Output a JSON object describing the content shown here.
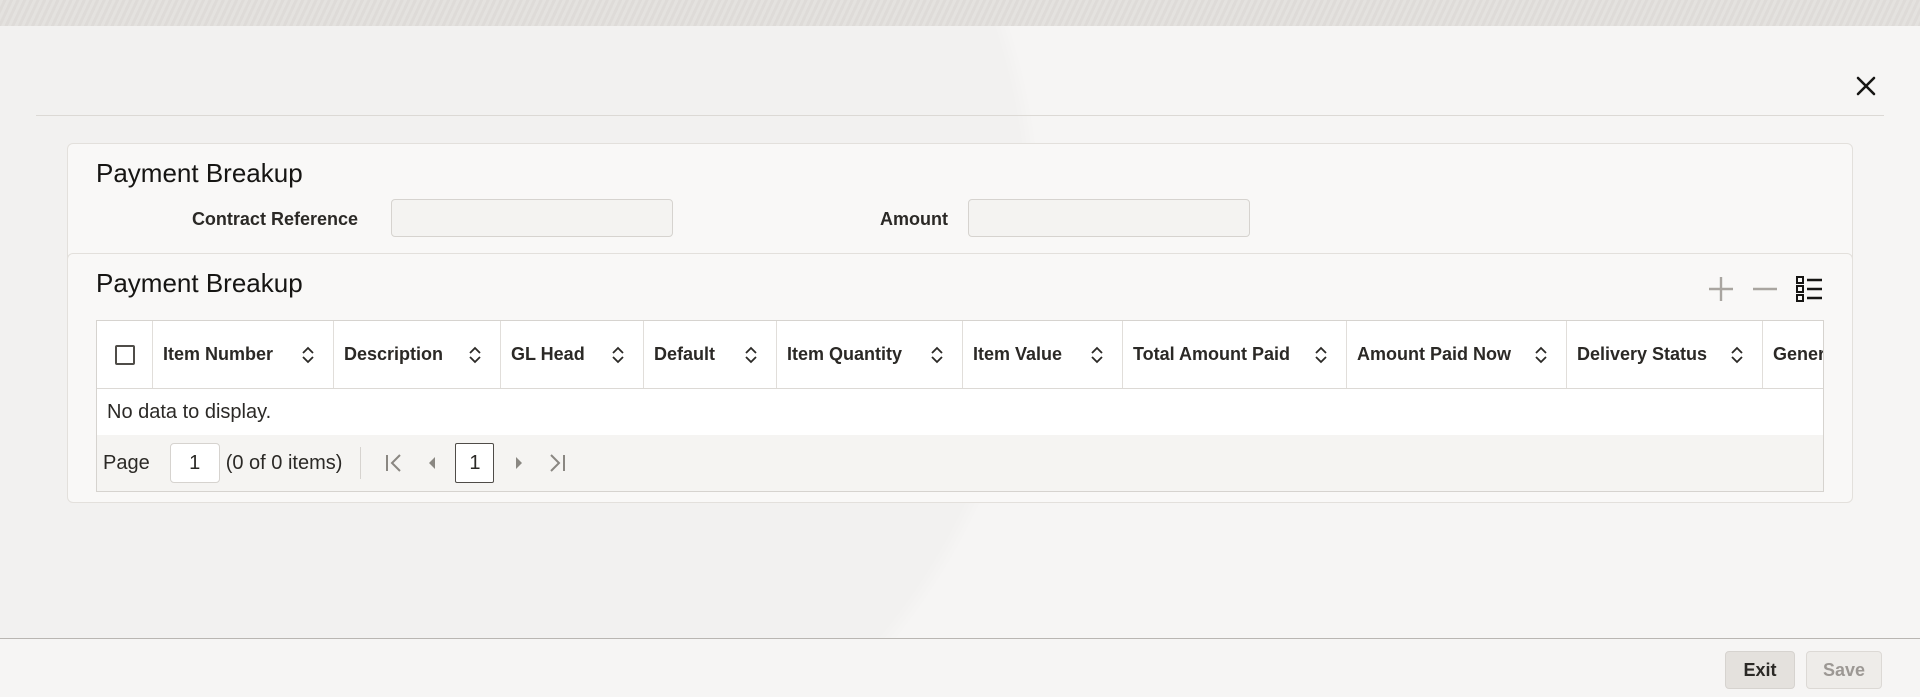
{
  "header": {
    "close_icon": "close-icon"
  },
  "section1": {
    "title": "Payment Breakup",
    "contract_reference_label": "Contract Reference",
    "contract_reference_value": "",
    "amount_label": "Amount",
    "amount_value": ""
  },
  "section2": {
    "title": "Payment Breakup",
    "toolbar": {
      "add_icon": "plus-icon",
      "remove_icon": "minus-icon",
      "columns_icon": "list-icon"
    },
    "columns": [
      "Item Number",
      "Description",
      "GL Head",
      "Default",
      "Item Quantity",
      "Item Value",
      "Total Amount Paid",
      "Amount Paid Now",
      "Delivery Status",
      "Gener"
    ],
    "empty_message": "No data to display.",
    "pager": {
      "page_label": "Page",
      "page_value": "1",
      "count_text": "(0 of 0 items)",
      "current_page": "1"
    }
  },
  "footer": {
    "exit_label": "Exit",
    "save_label": "Save"
  }
}
